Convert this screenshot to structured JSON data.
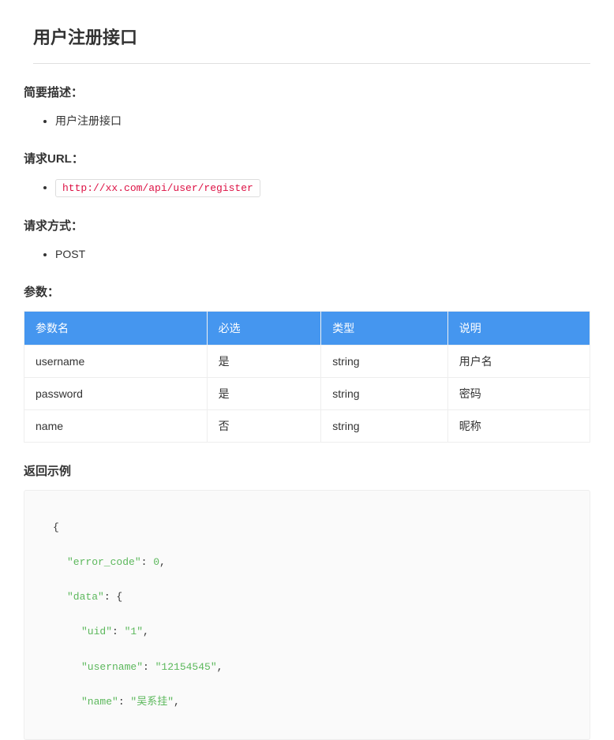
{
  "page_title": "用户注册接口",
  "sections": {
    "brief_heading": "简要描述：",
    "brief_item": "用户注册接口",
    "url_heading": "请求URL：",
    "url_value": "http://xx.com/api/user/register",
    "method_heading": "请求方式：",
    "method_value": "POST",
    "params_heading": "参数：",
    "example_heading": "返回示例"
  },
  "params_table": {
    "headers": [
      "参数名",
      "必选",
      "类型",
      "说明"
    ],
    "rows": [
      [
        "username",
        "是",
        "string",
        "用户名"
      ],
      [
        "password",
        "是",
        "string",
        "密码"
      ],
      [
        "name",
        "否",
        "string",
        "昵称"
      ]
    ]
  },
  "example": {
    "line1_open": "{",
    "line2_key": "\"error_code\"",
    "line2_sep": ": ",
    "line2_val": "0",
    "line2_end": ",",
    "line3_key": "\"data\"",
    "line3_sep": ": ",
    "line3_open": "{",
    "line4_key": "\"uid\"",
    "line4_sep": ": ",
    "line4_val": "\"1\"",
    "line4_end": ",",
    "line5_key": "\"username\"",
    "line5_sep": ": ",
    "line5_val": "\"12154545\"",
    "line5_end": ",",
    "line6_key": "\"name\"",
    "line6_sep": ": ",
    "line6_val": "\"吴系挂\"",
    "line6_end": ","
  }
}
